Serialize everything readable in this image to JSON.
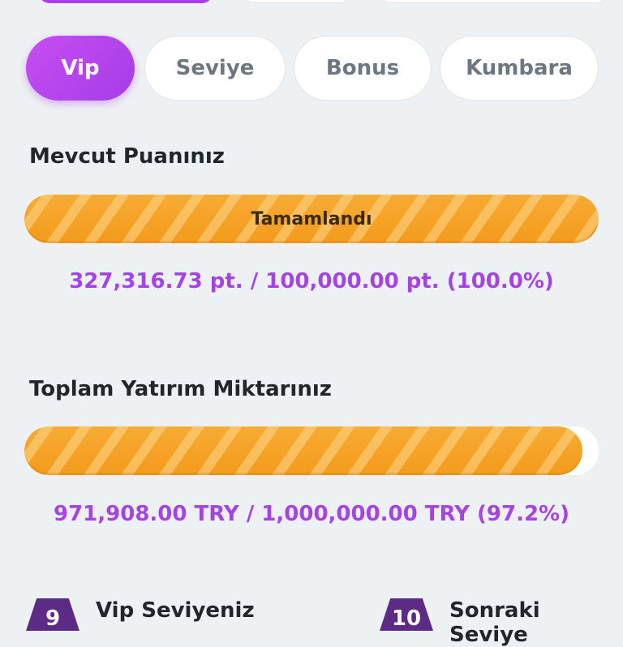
{
  "tabs": [
    {
      "label": "Vip",
      "active": true
    },
    {
      "label": "Seviye",
      "active": false
    },
    {
      "label": "Bonus",
      "active": false
    },
    {
      "label": "Kumbara",
      "active": false
    }
  ],
  "points": {
    "title": "Mevcut Puanınız",
    "status_label": "Tamamlandı",
    "progress_fraction": 1.0,
    "value_text": "327,316.73 pt. / 100,000.00 pt. (100.0%)"
  },
  "deposit": {
    "title": "Toplam Yatırım Miktarınız",
    "progress_fraction": 0.972,
    "value_text": "971,908.00 TRY / 1,000,000.00 TRY (97.2%)"
  },
  "levels": {
    "current_label": "Vip Seviyeniz",
    "current_level": "9",
    "next_label": "Sonraki Seviye",
    "next_level": "10"
  },
  "colors": {
    "accent": "#a93fe6",
    "progress": "#f5a52a",
    "stat_text": "#a445e3"
  }
}
